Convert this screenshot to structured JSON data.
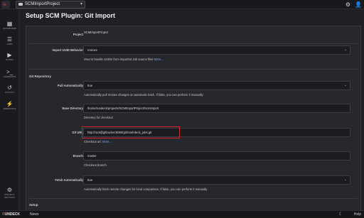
{
  "topbar": {
    "project": "SCMImportProject",
    "project_caret": "▾",
    "bell_icon": "🔔",
    "gear_icon": "⚙",
    "user_icon": "👤"
  },
  "sidebar": {
    "items": [
      {
        "icon": "▦",
        "label": "Dashboard"
      },
      {
        "icon": "☰",
        "label": "Jobs"
      },
      {
        "icon": "▶",
        "label": "Nodes"
      },
      {
        "icon": ">_",
        "label": "Commands"
      },
      {
        "icon": "↺",
        "label": "Activity"
      },
      {
        "icon": "⚡",
        "label": "Webhooks"
      }
    ],
    "settings": {
      "icon": "⚙",
      "label": "Project Settings"
    }
  },
  "page": {
    "title": "Setup SCM Plugin: Git Import"
  },
  "form": {
    "project_label": "Project",
    "project_value": "SCMImportProject",
    "uuid_label": "Import UUID Behavior",
    "uuid_value": "remove",
    "uuid_help": "How to handle UUIDs from imported Job source files",
    "more": "More...",
    "git_repo_section": "Git Repository",
    "pull_label": "Pull Automatically",
    "pull_value": "true",
    "pull_help": "Automatically pull remote changes on automatic fetch. If false, you can perform it manually",
    "basedir_label": "Base Directory",
    "basedir_value": "/home/rundeck/projects/SCMImportProject/ScmImport",
    "basedir_help": "Directory for checkout",
    "giturl_label": "Git URL",
    "giturl_value": "http://root@gitbucket:8080/git/root/rdeck_jobs.git",
    "giturl_help": "Checkout url.",
    "branch_label": "Branch",
    "branch_value": "master",
    "branch_help": "Checkout branch",
    "fetch_label": "Fetch Automatically",
    "fetch_value": "true",
    "fetch_help": "Automatically fetch remote changes for local comparison. If false, you can perform it manually",
    "setup_section": "Setup",
    "select_caret": "⌄",
    "highlight_color": "#d4242b"
  },
  "footer": {
    "brand_r": "R",
    "brand_rest": "UNDECK",
    "news": "News",
    "moon_icon": "☾",
    "help": "Help"
  }
}
